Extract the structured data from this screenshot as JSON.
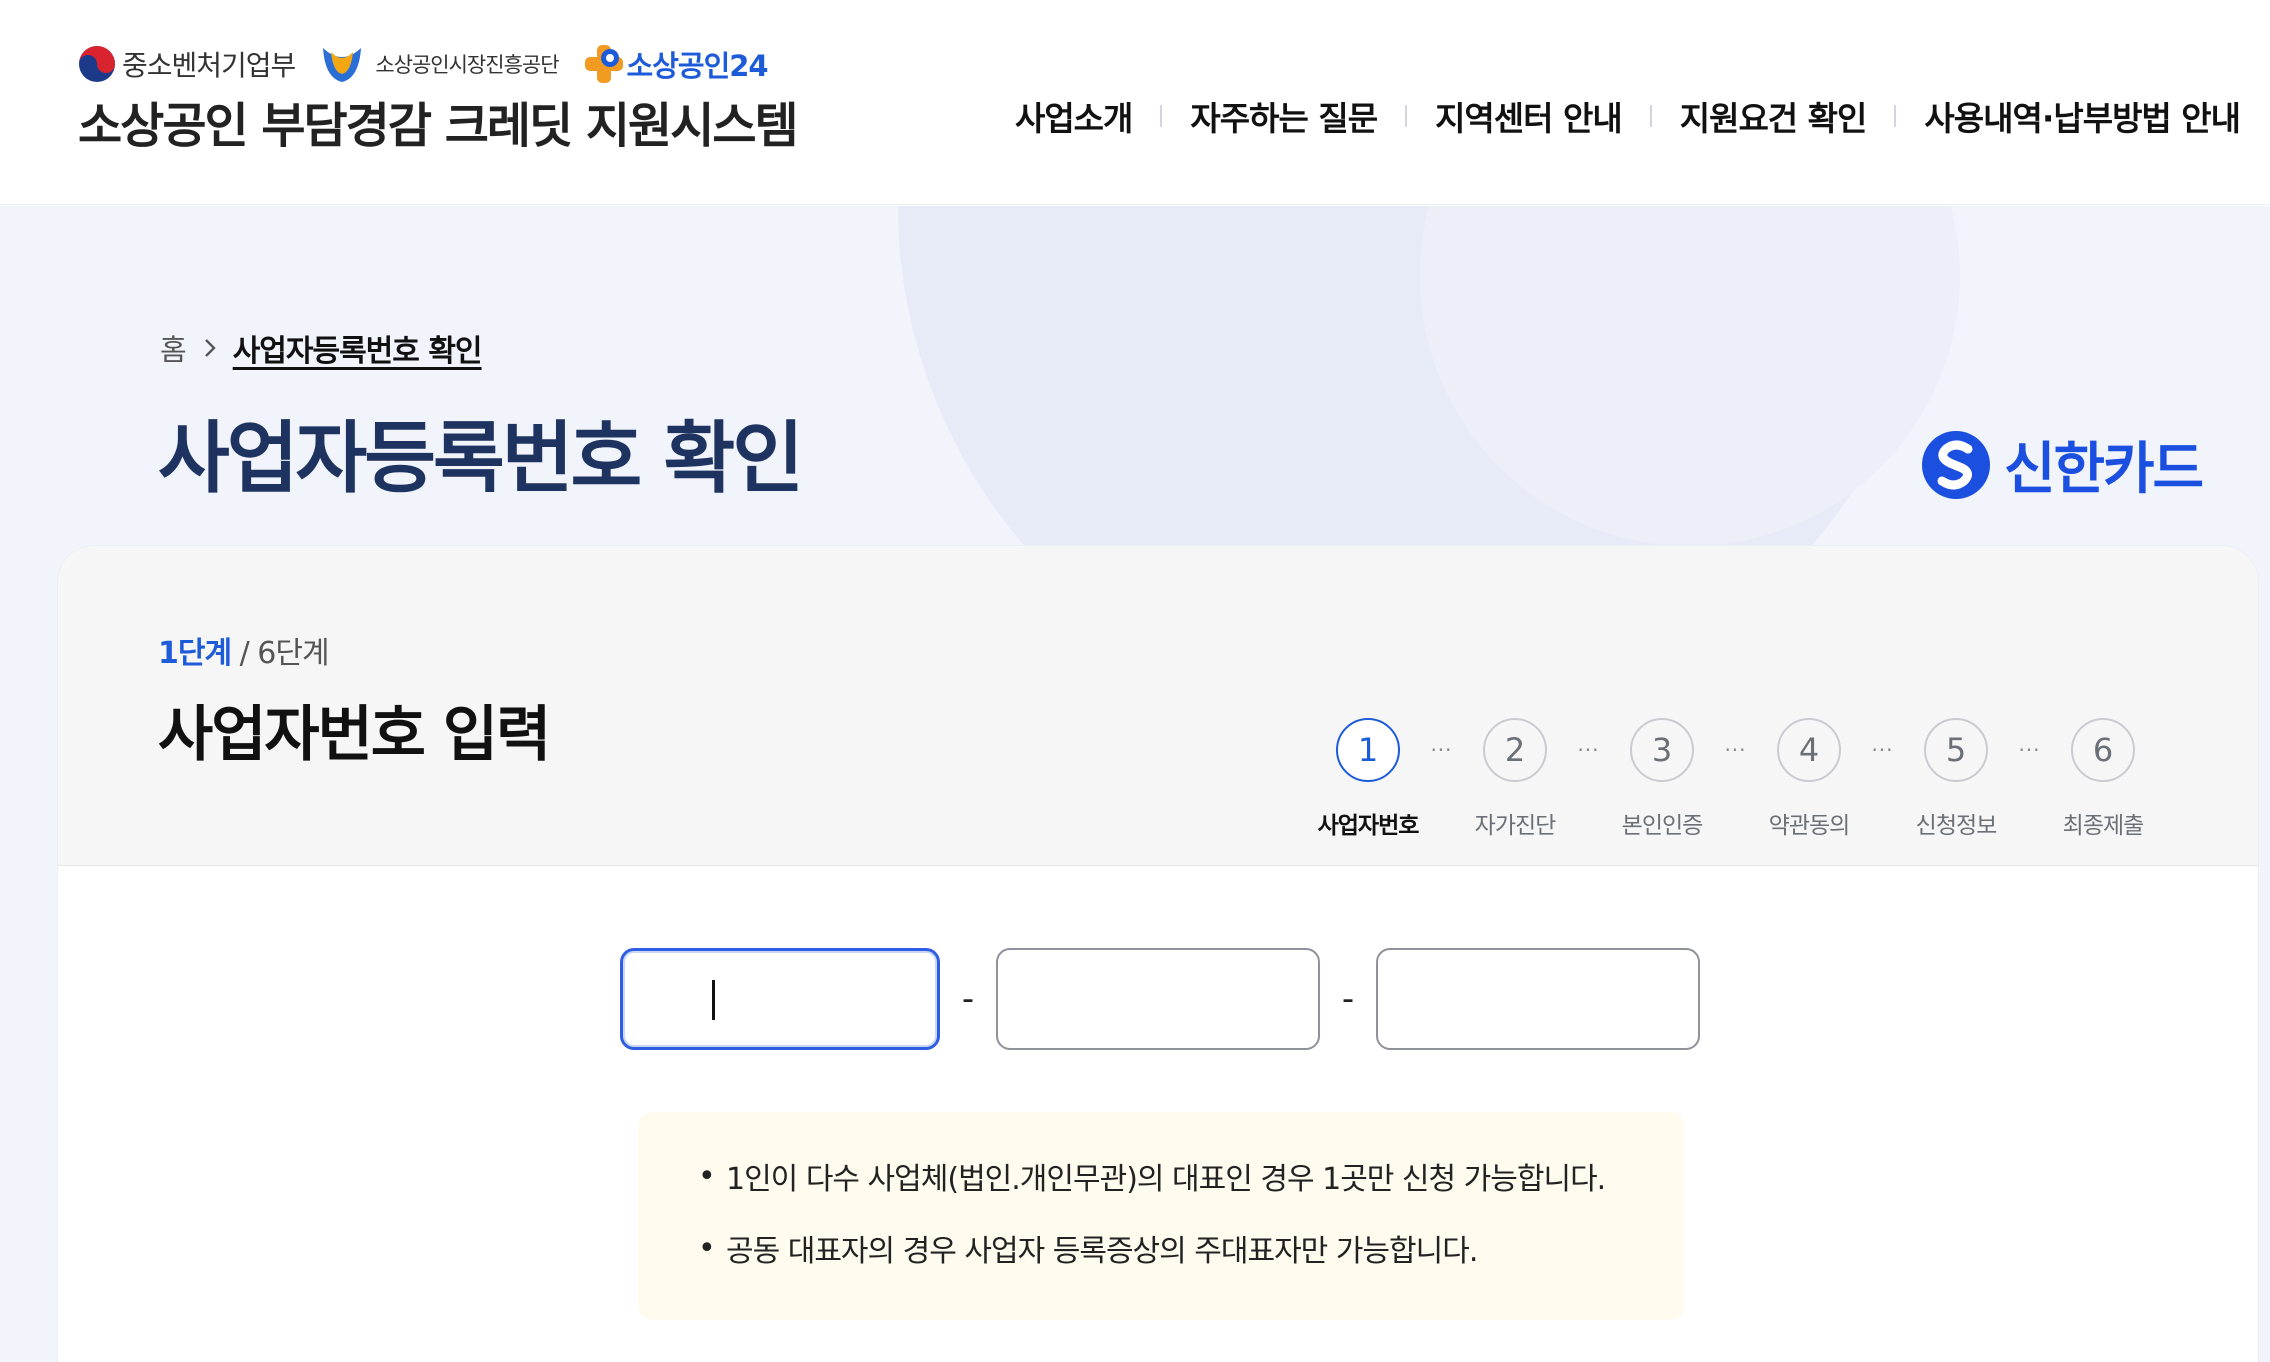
{
  "header": {
    "logos": [
      {
        "label": "중소벤처기업부",
        "icon": "taegeuk-icon"
      },
      {
        "label": "소상공인시장진흥공단",
        "icon": "semas-icon"
      },
      {
        "label": "소상공인24",
        "icon": "sosang24-icon"
      }
    ],
    "site_title": "소상공인 부담경감 크레딧 지원시스템",
    "nav": [
      "사업소개",
      "자주하는 질문",
      "지역센터 안내",
      "지원요건 확인",
      "사용내역·납부방법 안내"
    ]
  },
  "breadcrumb": {
    "home": "홈",
    "current": "사업자등록번호 확인"
  },
  "page_title": "사업자등록번호 확인",
  "brand": {
    "name": "신한카드",
    "color": "#1a4fe0"
  },
  "step_info": {
    "current": "1단계",
    "total": " / 6단계",
    "title": "사업자번호 입력"
  },
  "steps": [
    {
      "num": "1",
      "label": "사업자번호"
    },
    {
      "num": "2",
      "label": "자가진단"
    },
    {
      "num": "3",
      "label": "본인인증"
    },
    {
      "num": "4",
      "label": "약관동의"
    },
    {
      "num": "5",
      "label": "신청정보"
    },
    {
      "num": "6",
      "label": "최종제출"
    }
  ],
  "step_dots": "···",
  "bizno": {
    "part1": "",
    "part2": "",
    "part3": "",
    "separator": "-"
  },
  "notice": [
    "1인이 다수 사업체(법인.개인무관)의 대표인 경우 1곳만 신청 가능합니다.",
    "공동 대표자의 경우 사업자 등록증상의 주대표자만 가능합니다."
  ],
  "colors": {
    "accent": "#1e5bd8",
    "title": "#1f3361",
    "notice_bg": "#fffbee"
  }
}
